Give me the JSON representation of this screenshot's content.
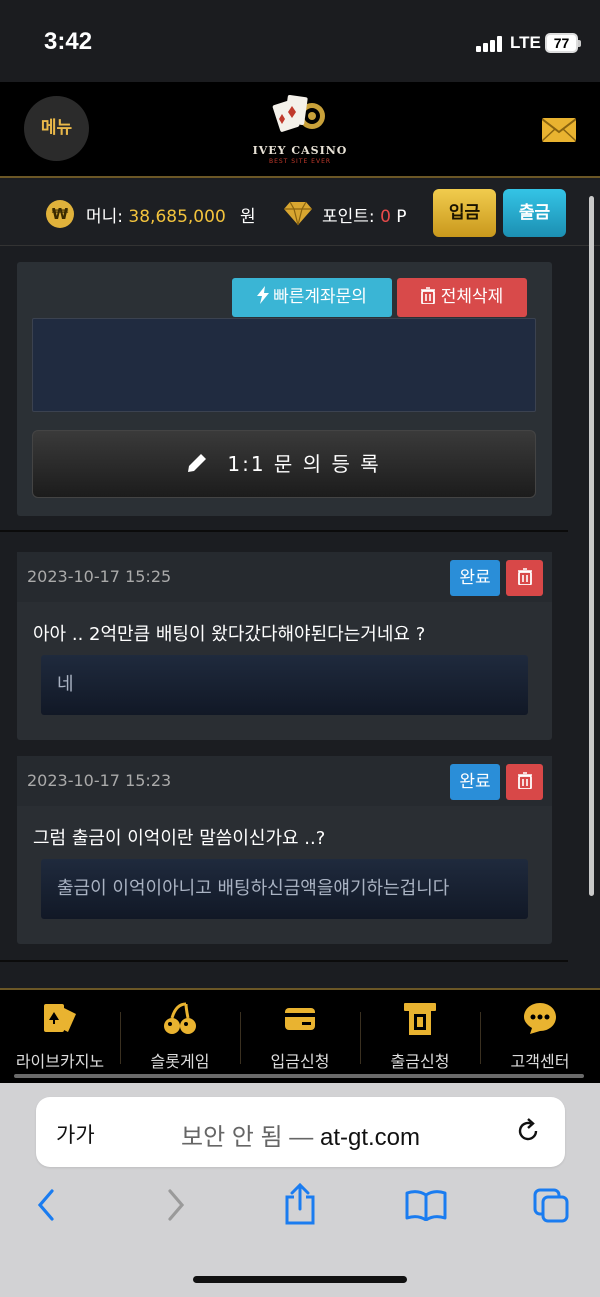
{
  "status_bar": {
    "time": "3:42",
    "network": "LTE",
    "battery": "77"
  },
  "header": {
    "menu_label": "메뉴",
    "logo_text": "IVEY CASINO",
    "logo_sub": "BEST SITE EVER"
  },
  "balance": {
    "money_label": "머니:",
    "money_value": "38,685,000",
    "money_unit": "원",
    "point_label": "포인트:",
    "point_value": "0",
    "point_unit": "P",
    "coin_symbol": "₩",
    "deposit_label": "입금",
    "withdraw_label": "출금"
  },
  "form": {
    "quick_account_label": "빠른계좌문의",
    "delete_all_label": "전체삭제",
    "register_label": "1:1 문 의 등 록"
  },
  "posts": [
    {
      "date": "2023-10-17 15:25",
      "status": "완료",
      "question": "아아 .. 2억만큼 배팅이 왔다갔다해야된다는거네요 ?",
      "answer": "네"
    },
    {
      "date": "2023-10-17 15:23",
      "status": "완료",
      "question": "그럼 출금이 이억이란 말씀이신가요 ..?",
      "answer": "출금이 이억이아니고 배팅하신금액을얘기하는겁니다"
    }
  ],
  "bottom_nav": [
    {
      "label": "라이브카지노",
      "icon": "card-icon"
    },
    {
      "label": "슬롯게임",
      "icon": "cherry-icon"
    },
    {
      "label": "입금신청",
      "icon": "credit-card-icon"
    },
    {
      "label": "출금신청",
      "icon": "atm-icon"
    },
    {
      "label": "고객센터",
      "icon": "chat-bubble-icon"
    }
  ],
  "browser": {
    "text_size_label": "가가",
    "insecure_label": "보안 안 됨 —",
    "url": "at-gt.com"
  },
  "colors": {
    "gold": "#f2c33d",
    "cyan": "#3ab5d5",
    "red": "#d84a4a",
    "blue": "#2a8ed8"
  }
}
